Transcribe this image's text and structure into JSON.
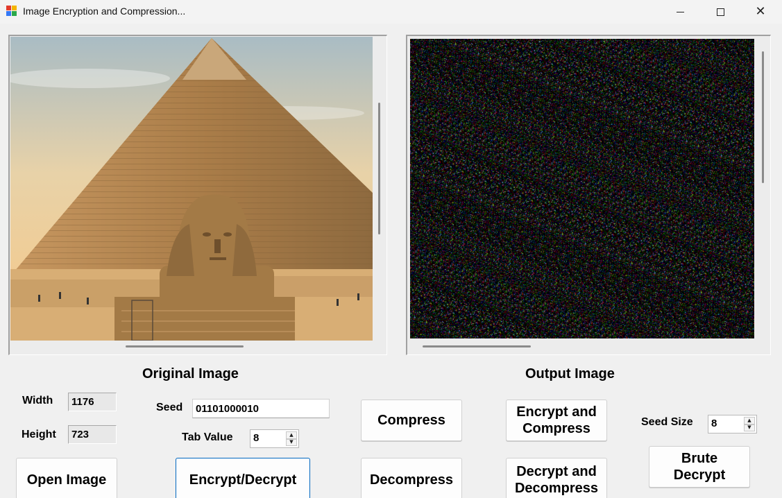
{
  "window": {
    "title": "Image Encryption and Compression...",
    "icon": "app-window-icon",
    "controls": {
      "minimize": "minimize-icon",
      "maximize": "maximize-icon",
      "close_glyph": "✕"
    }
  },
  "panels": {
    "original": {
      "heading": "Original Image",
      "content": "pyramid-and-sphinx-photo"
    },
    "output": {
      "heading": "Output Image",
      "content": "encrypted-noise-image"
    }
  },
  "fields": {
    "width_label": "Width",
    "width_value": "1176",
    "height_label": "Height",
    "height_value": "723",
    "seed_label": "Seed",
    "seed_value": "01101000010",
    "tab_value_label": "Tab Value",
    "tab_value": "8",
    "seed_size_label": "Seed Size",
    "seed_size_value": "8"
  },
  "buttons": {
    "open_image": "Open Image",
    "encrypt_decrypt": "Encrypt/Decrypt",
    "compress": "Compress",
    "decompress": "Decompress",
    "encrypt_compress": [
      "Encrypt and",
      "Compress"
    ],
    "decrypt_decompress": [
      "Decrypt and",
      "Decompress"
    ],
    "brute_decrypt": [
      "Brute",
      "Decrypt"
    ]
  },
  "colors": {
    "background": "#f0f0f0",
    "focus_border": "#0067c0",
    "sky_top": "#b8c8cf",
    "sky_bottom": "#f2c98a",
    "pyramid": "#b48a55",
    "sand": "#d9b07a"
  }
}
